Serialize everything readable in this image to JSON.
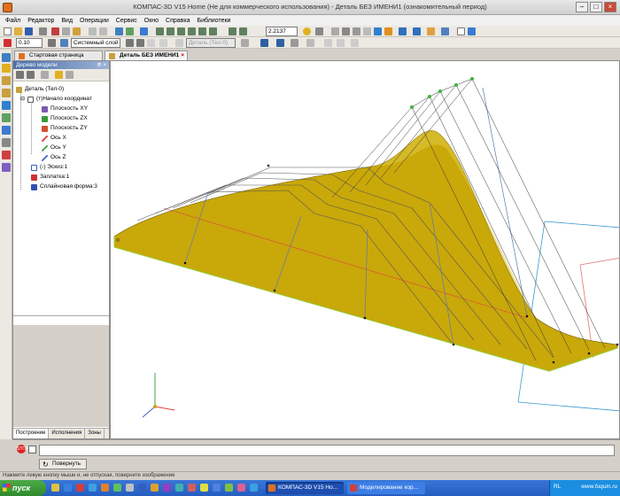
{
  "window": {
    "title": "КОМПАС-3D V15 Home (Не для коммерческого использования) - Деталь БЕЗ ИМЕНИ1 (ознакомительный период)"
  },
  "menu": [
    "Файл",
    "Редактор",
    "Вид",
    "Операции",
    "Сервис",
    "Окно",
    "Справка",
    "Библиотеки"
  ],
  "toolbar": {
    "zoom_value": "2.2137",
    "line_width": "0.10",
    "layer": "Системный слой (0)",
    "detail_selector": "Деталь (Тел-0)"
  },
  "tabs": [
    {
      "label": "Стартовая страница",
      "active": false
    },
    {
      "label": "Деталь БЕЗ ИМЕНИ1",
      "active": true
    }
  ],
  "tree_panel": {
    "title": "Дерево модели",
    "controls": "Ф ×",
    "items": [
      {
        "label": "Деталь (Тел-0)",
        "icon": "part-icon",
        "color": "#c8a040"
      },
      {
        "label": "(т)Начало координат",
        "icon": "origin-icon",
        "color": "#555555"
      },
      {
        "label": "Плоскость XY",
        "icon": "plane-icon",
        "color": "#7a5ab0"
      },
      {
        "label": "Плоскость ZX",
        "icon": "plane-icon",
        "color": "#3a9a3a"
      },
      {
        "label": "Плоскость ZY",
        "icon": "plane-icon",
        "color": "#d05030"
      },
      {
        "label": "Ось X",
        "icon": "axis-icon",
        "color": "#d04040"
      },
      {
        "label": "Ось Y",
        "icon": "axis-icon",
        "color": "#40a040"
      },
      {
        "label": "Ось Z",
        "icon": "axis-icon",
        "color": "#4060d0"
      },
      {
        "label": "(-) Эскиз:1",
        "icon": "sketch-icon",
        "color": "#3060c0"
      },
      {
        "label": "Заплатка:1",
        "icon": "patch-icon",
        "color": "#d03030"
      },
      {
        "label": "Сплайновая форма:3",
        "icon": "spline-icon",
        "color": "#3050b0"
      }
    ],
    "bottom_tabs": [
      "Построение",
      "Исполнения",
      "Зоны"
    ]
  },
  "viewport": {
    "surface_color": "#c9a80a",
    "edge_color": "#9acd32"
  },
  "command_bar": {
    "rotate_label": "Повернуть"
  },
  "status_hint": "Нажмите левую кнопку мыши и, не отпуская, поверните изображение",
  "taskbar": {
    "start_label": "пуск",
    "tasks": [
      "КОМПАС-3D V15 Ho...",
      "Моделирование кор..."
    ],
    "lang": "RL",
    "watermark": "www.fuquin.ru"
  }
}
